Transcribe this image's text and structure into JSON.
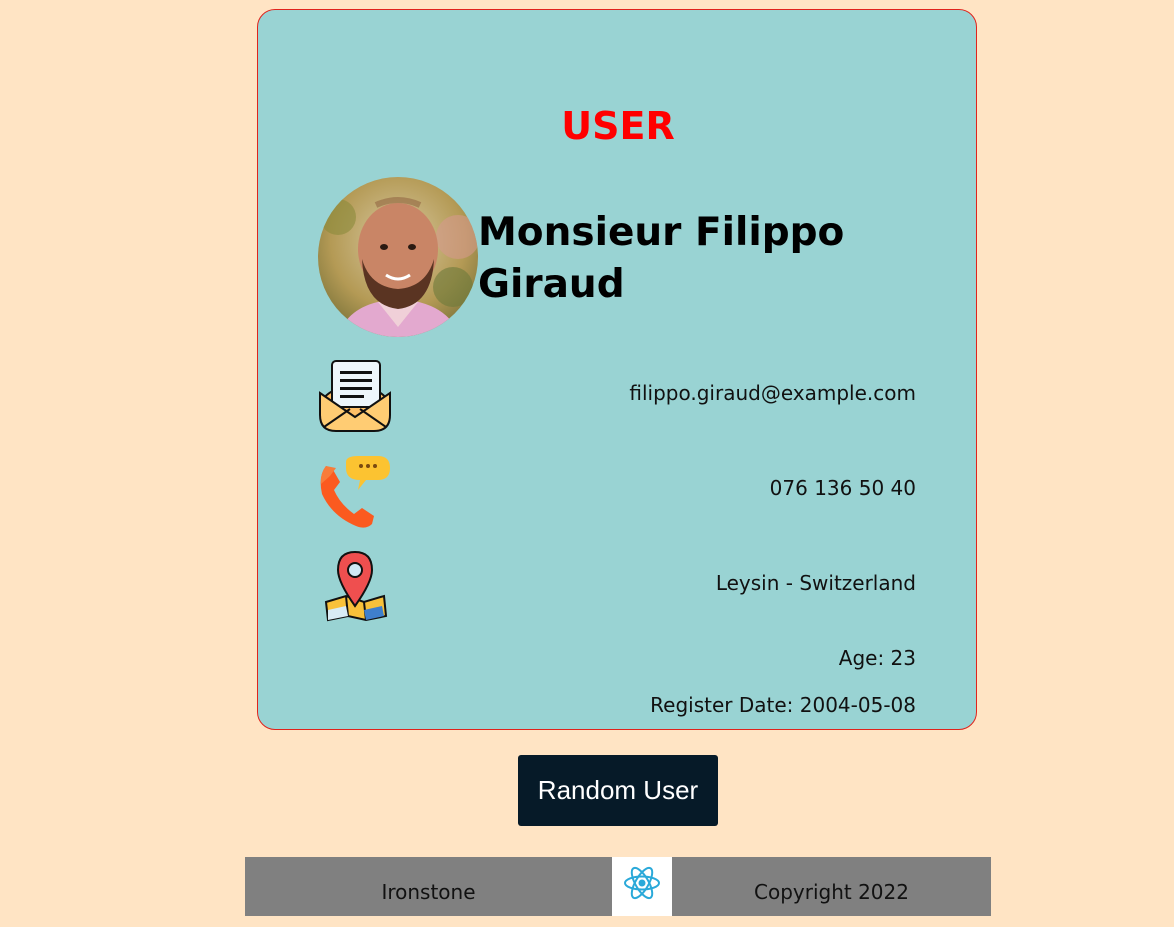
{
  "card": {
    "title": "USER",
    "user": {
      "name": "Monsieur Filippo Giraud",
      "email": "filippo.giraud@example.com",
      "phone": "076 136 50 40",
      "location": "Leysin - Switzerland",
      "age": "Age: 23",
      "register_date": "Register Date: 2004-05-08"
    },
    "icons": {
      "email": "envelope-letter-icon",
      "phone": "phone-chat-icon",
      "location": "map-pin-icon"
    }
  },
  "actions": {
    "random_label": "Random User"
  },
  "footer": {
    "left_text": "Ironstone",
    "logo": "react-logo-icon",
    "right_text": "Copyright 2022"
  },
  "colors": {
    "background": "#ffe4c4",
    "card": "#99d3d3",
    "card_border": "#e0231c",
    "title": "#ff0000",
    "button": "#061a28",
    "footer": "#808080",
    "react": "#2aa9d9"
  }
}
